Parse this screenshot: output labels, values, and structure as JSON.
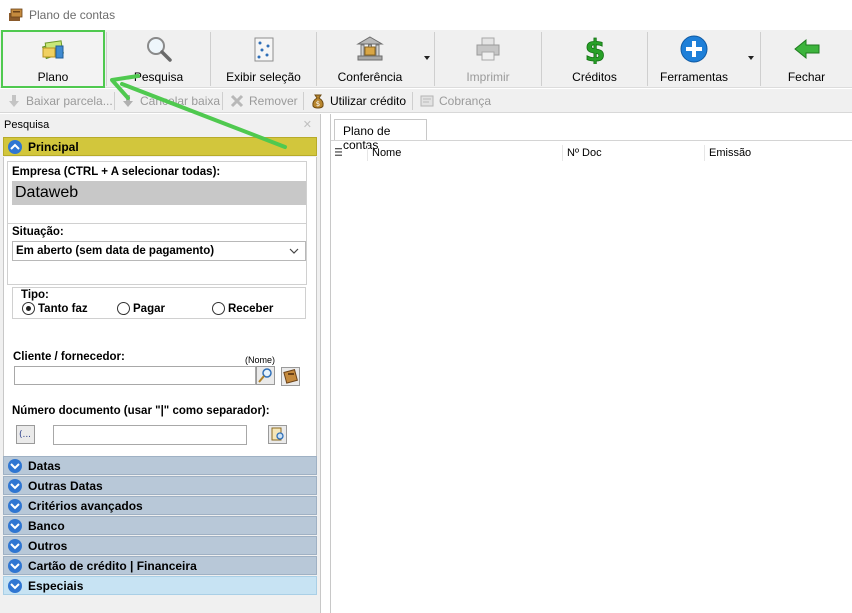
{
  "window": {
    "title": "Plano de contas"
  },
  "toolbar": {
    "buttons": [
      {
        "label": "Plano",
        "icon": "plan-money-icon",
        "state": "selected"
      },
      {
        "label": "Pesquisa",
        "icon": "magnifier-icon"
      },
      {
        "label": "Exibir seleção",
        "icon": "selection-icon"
      },
      {
        "label": "Conferência",
        "icon": "bank-icon"
      },
      {
        "label": "Imprimir",
        "icon": "printer-icon",
        "state": "disabled"
      },
      {
        "label": "Créditos",
        "icon": "dollar-icon"
      },
      {
        "label": "Ferramentas",
        "icon": "plus-circle-icon"
      },
      {
        "label": "Fechar",
        "icon": "back-arrow-icon"
      }
    ]
  },
  "toolbar2": {
    "buttons": [
      {
        "label": "Baixar parcela...",
        "state": "disabled"
      },
      {
        "label": "Cancelar baixa",
        "state": "disabled"
      },
      {
        "label": "Remover",
        "state": "disabled"
      },
      {
        "label": "Utilizar crédito"
      },
      {
        "label": "Cobrança",
        "state": "disabled"
      }
    ]
  },
  "left_panel": {
    "header": "Pesquisa",
    "principal": {
      "title": "Principal",
      "empresa_label": "Empresa (CTRL + A selecionar todas):",
      "empresa_value": "Dataweb",
      "situacao_label": "Situação:",
      "situacao_value": "Em aberto (sem data de pagamento)",
      "tipo_label": "Tipo:",
      "tipo_options": [
        "Tanto faz",
        "Pagar",
        "Receber"
      ],
      "tipo_selected": "Tanto faz",
      "cliente_label": "Cliente / fornecedor:",
      "cliente_hint": "(Nome)",
      "cliente_value": "",
      "numero_label": "Número documento (usar \"|\" como separador):",
      "numero_value": ""
    },
    "groups": [
      "Datas",
      "Outras Datas",
      "Critérios avançados",
      "Banco",
      "Outros",
      "Cartão de crédito | Financeira",
      "Especiais"
    ]
  },
  "right_panel": {
    "tab": "Plano de contas",
    "columns": [
      "Nome",
      "Nº Doc",
      "Emissão"
    ]
  },
  "colors": {
    "principal_header": "#d2c63c",
    "group_header": "#b8c8d8",
    "group_header_active": "#c7e3f3",
    "annotation_green": "#4fc94f"
  }
}
